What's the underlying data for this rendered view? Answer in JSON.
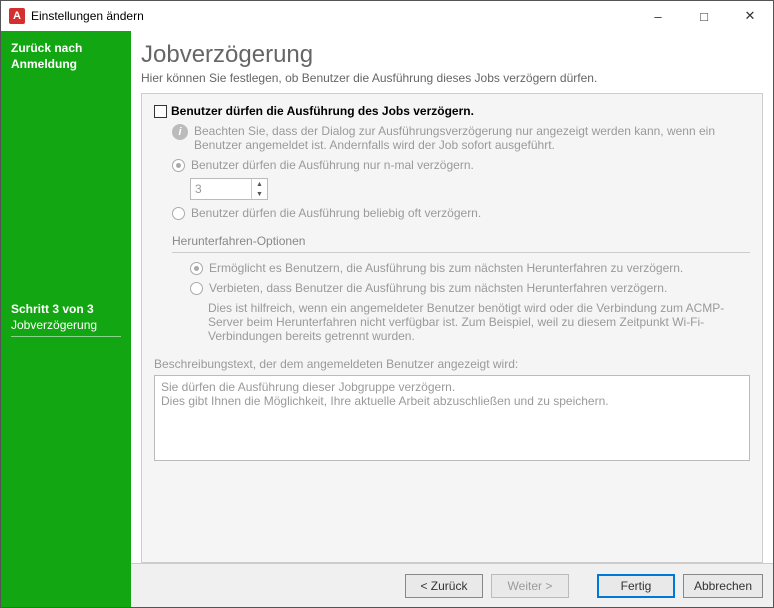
{
  "titlebar": {
    "app_letter": "A",
    "title": "Einstellungen ändern"
  },
  "sidebar": {
    "back_line1": "Zurück nach",
    "back_line2": "Anmeldung",
    "step_label": "Schritt 3 von 3",
    "step_name": "Jobverzögerung"
  },
  "header": {
    "title": "Jobverzögerung",
    "subtitle": "Hier können Sie festlegen, ob Benutzer die Ausführung dieses Jobs verzögern dürfen."
  },
  "panel": {
    "allow_delay_label": "Benutzer dürfen die Ausführung des Jobs verzögern.",
    "info_text": "Beachten Sie, dass der Dialog zur Ausführungsverzögerung nur angezeigt werden kann, wenn ein Benutzer angemeldet ist. Andernfalls wird der Job sofort ausgeführt.",
    "radio_n_times": "Benutzer dürfen die Ausführung nur n-mal verzögern.",
    "n_value": "3",
    "radio_unlimited": "Benutzer dürfen die Ausführung beliebig oft verzögern.",
    "shutdown_group": "Herunterfahren-Optionen",
    "shutdown_allow": "Ermöglicht es Benutzern, die Ausführung bis zum nächsten Herunterfahren zu verzögern.",
    "shutdown_forbid": "Verbieten, dass Benutzer die Ausführung bis zum nächsten Herunterfahren verzögern.",
    "shutdown_help": "Dies ist hilfreich, wenn ein angemeldeter Benutzer benötigt wird oder die Verbindung zum ACMP-Server beim Herunterfahren nicht verfügbar ist. Zum Beispiel, weil zu diesem Zeitpunkt Wi-Fi-Verbindungen bereits getrennt wurden.",
    "desc_label": "Beschreibungstext, der dem angemeldeten Benutzer angezeigt wird:",
    "desc_value": "Sie dürfen die Ausführung dieser Jobgruppe verzögern.\nDies gibt Ihnen die Möglichkeit, Ihre aktuelle Arbeit abzuschließen und zu speichern."
  },
  "footer": {
    "back": "< Zurück",
    "next": "Weiter >",
    "finish": "Fertig",
    "cancel": "Abbrechen"
  }
}
